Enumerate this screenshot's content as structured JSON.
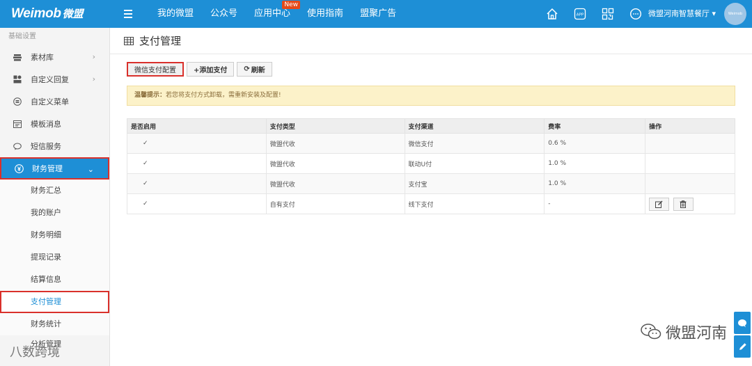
{
  "brand": {
    "logo_latin": "Weimob",
    "logo_cn": "微盟"
  },
  "nav": [
    {
      "label": "我的微盟"
    },
    {
      "label": "公众号"
    },
    {
      "label": "应用中心",
      "badge": "New"
    },
    {
      "label": "使用指南"
    },
    {
      "label": "盟聚广告"
    }
  ],
  "top_icons": [
    "home-icon",
    "app-icon",
    "qrcode-icon",
    "chat-icon"
  ],
  "top_icon_app_text": "APP",
  "user": {
    "name": "微盟河南智慧餐厅",
    "avatar_text": "Weimob"
  },
  "sidebar": {
    "section_label": "基础设置",
    "items": [
      {
        "label": "素材库",
        "icon": "stack-icon",
        "has_arrow": true
      },
      {
        "label": "自定义回复",
        "icon": "reply-icon",
        "has_arrow": true
      },
      {
        "label": "自定义菜单",
        "icon": "menu-circle-icon",
        "has_arrow": false
      },
      {
        "label": "模板消息",
        "icon": "template-icon",
        "has_arrow": false
      },
      {
        "label": "短信服务",
        "icon": "sms-icon",
        "has_arrow": false
      }
    ],
    "active_group": {
      "label": "财务管理",
      "icon": "yen-icon"
    },
    "sub_items": [
      "财务汇总",
      "我的账户",
      "财务明细",
      "提现记录",
      "结算信息",
      "支付管理",
      "财务统计"
    ],
    "current_sub": "支付管理",
    "partial_item": "分析管理"
  },
  "page": {
    "title": "支付管理",
    "buttons": {
      "wechat_config": "微信支付配置",
      "add": "+添加支付",
      "refresh": "刷新"
    },
    "warning": {
      "label": "温馨提示：",
      "text": "若您将支付方式卸载，需重新安装及配置!"
    }
  },
  "table": {
    "headers": [
      "是否启用",
      "支付类型",
      "支付渠道",
      "费率",
      "操作"
    ],
    "rows": [
      {
        "enabled": "✓",
        "type": "微盟代收",
        "channel": "微信支付",
        "rate": "0.6 %",
        "has_ops": false
      },
      {
        "enabled": "✓",
        "type": "微盟代收",
        "channel": "联动U付",
        "rate": "1.0 %",
        "has_ops": false
      },
      {
        "enabled": "✓",
        "type": "微盟代收",
        "channel": "支付宝",
        "rate": "1.0 %",
        "has_ops": false
      },
      {
        "enabled": "✓",
        "type": "自有支付",
        "channel": "线下支付",
        "rate": "-",
        "has_ops": true
      }
    ]
  },
  "watermarks": {
    "right": "微盟河南",
    "left": "八数跨境"
  },
  "colors": {
    "brand_blue": "#1e8fd6",
    "highlight_red": "#d9302b",
    "warning_bg": "#fcf2c9"
  }
}
